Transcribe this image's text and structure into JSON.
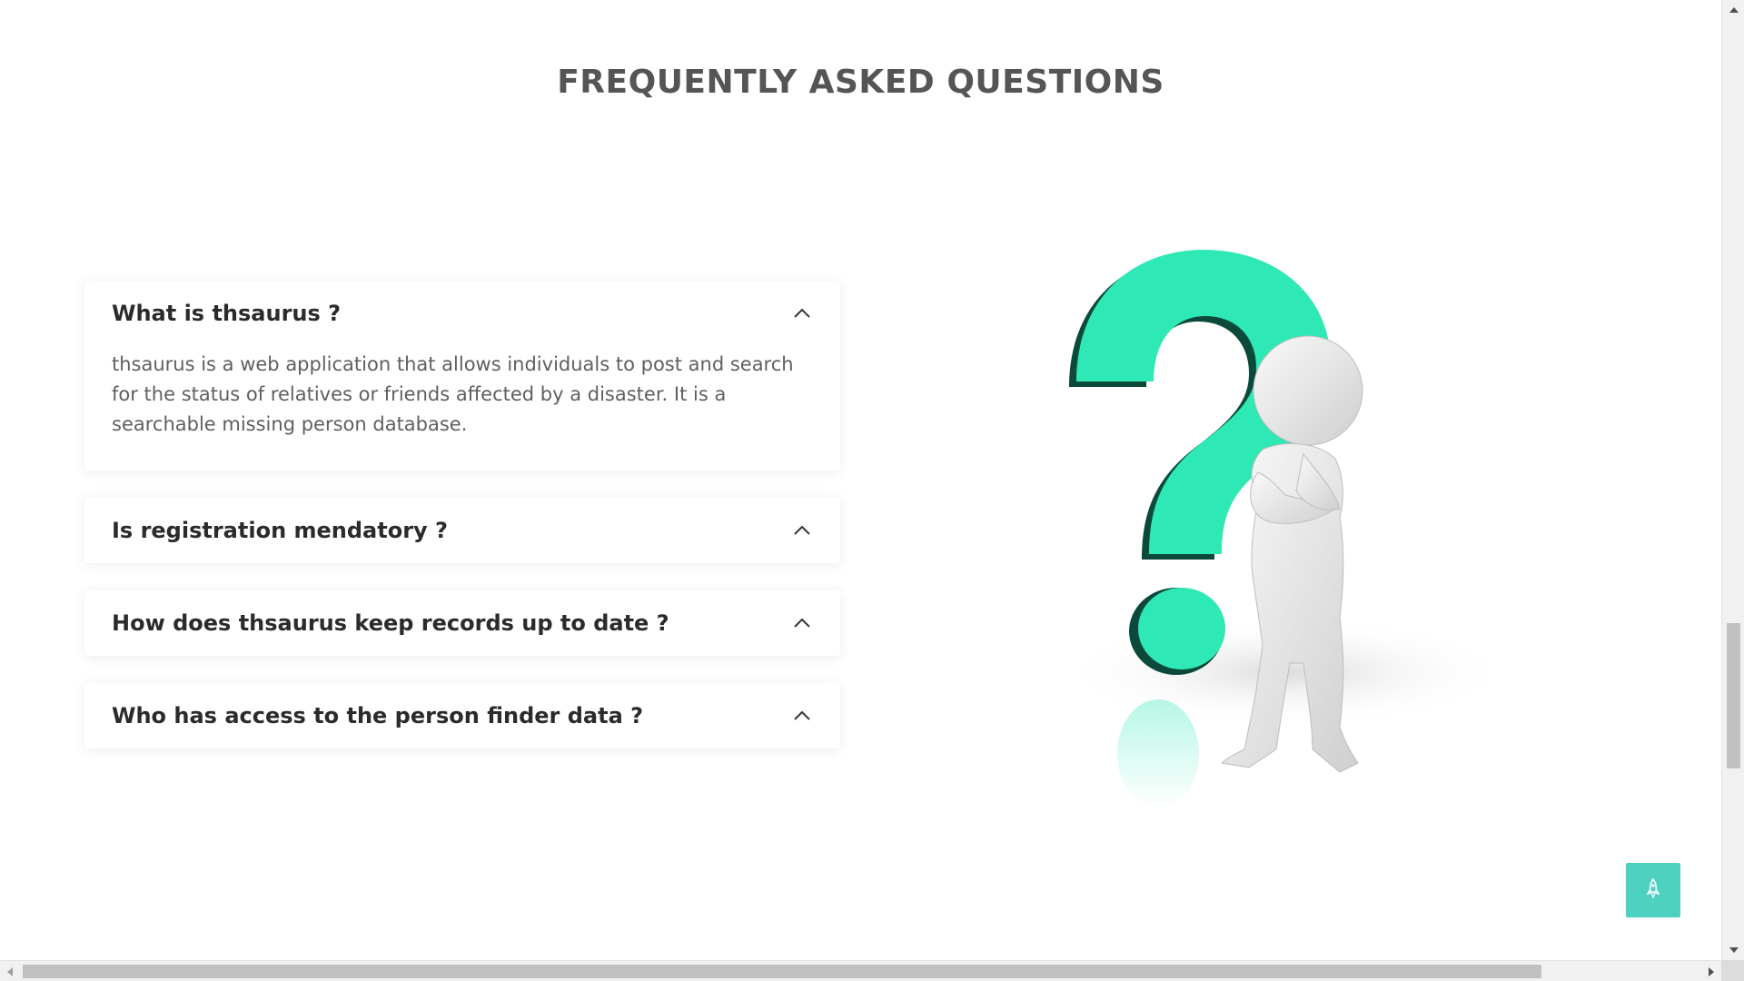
{
  "section": {
    "title": "FREQUENTLY ASKED QUESTIONS"
  },
  "faq": {
    "items": [
      {
        "question": "What is thsaurus ?",
        "answer": "thsaurus is a web application that allows individuals to post and search for the status of relatives or friends affected by a disaster. It is a searchable missing person database.",
        "expanded": true
      },
      {
        "question": "Is registration mendatory ?",
        "expanded": false
      },
      {
        "question": "How does thsaurus keep records up to date ?",
        "expanded": false
      },
      {
        "question": "Who has access to the person finder data ?",
        "expanded": false
      }
    ]
  },
  "illustration": {
    "icon": "question-mark-figure-illustration",
    "accent_color": "#2ee8b6",
    "dark_color": "#0b4a3a"
  },
  "scroll_top_button": {
    "icon": "rocket-icon",
    "color": "#4fd1c1"
  }
}
